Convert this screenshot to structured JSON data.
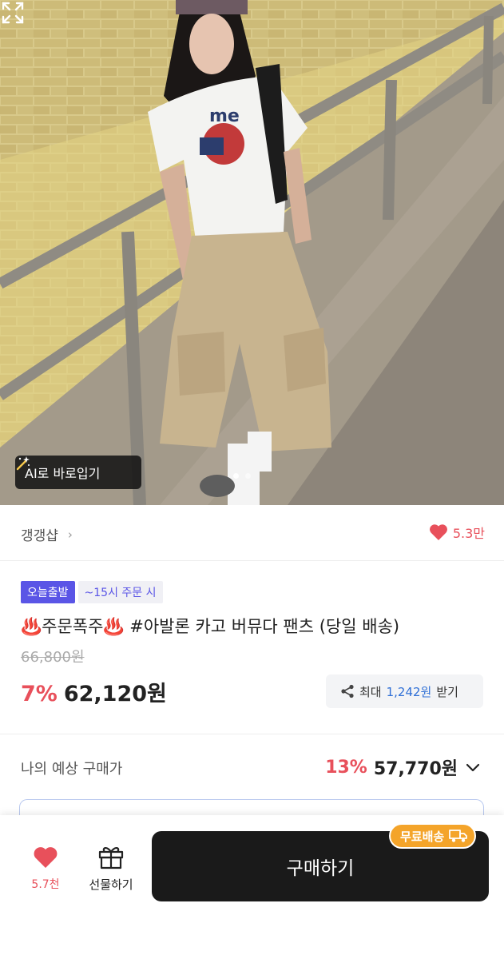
{
  "hero": {
    "ai_button_label": "AI로 바로입기",
    "wand_icon": "magic-wand-icon",
    "expand_icon": "expand-icon"
  },
  "shop": {
    "name": "갱갱샵",
    "chevron": "›",
    "likes": "5.3만"
  },
  "product": {
    "badge_today": "오늘출발",
    "badge_time": "~15시 주문 시",
    "title": "♨️주문폭주♨️ #아발론 카고 버뮤다 팬츠 (당일 배송)",
    "original_price": "66,800원",
    "discount": "7%",
    "price": "62,120원",
    "coupon": {
      "prefix": "최대",
      "amount": "1,242원",
      "suffix": "받기"
    }
  },
  "expected": {
    "label": "나의 예상 구매가",
    "discount": "13%",
    "price": "57,770원"
  },
  "bottom_bar": {
    "wish_count": "5.7천",
    "gift_label": "선물하기",
    "buy_label": "구매하기",
    "free_shipping": "무료배송"
  },
  "colors": {
    "accent_red": "#e8505b",
    "badge_purple": "#5a55e6",
    "link_blue": "#2f6fd6",
    "buy_black": "#1a1a1a",
    "shipping_orange": "#f4a42a"
  }
}
